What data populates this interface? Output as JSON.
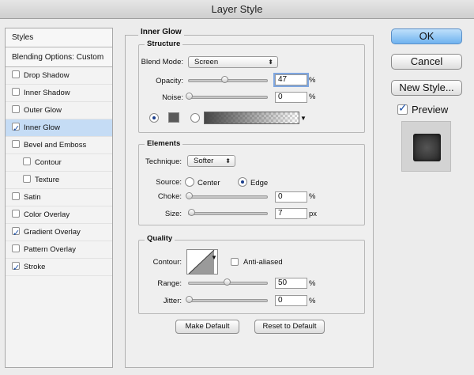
{
  "window": {
    "title": "Layer Style"
  },
  "sidebar": {
    "header": "Styles",
    "blending": "Blending Options: Custom",
    "items": [
      {
        "label": "Drop Shadow",
        "checked": false
      },
      {
        "label": "Inner Shadow",
        "checked": false
      },
      {
        "label": "Outer Glow",
        "checked": false
      },
      {
        "label": "Inner Glow",
        "checked": true
      },
      {
        "label": "Bevel and Emboss",
        "checked": false
      },
      {
        "label": "Contour",
        "checked": false
      },
      {
        "label": "Texture",
        "checked": false
      },
      {
        "label": "Satin",
        "checked": false
      },
      {
        "label": "Color Overlay",
        "checked": false
      },
      {
        "label": "Gradient Overlay",
        "checked": true
      },
      {
        "label": "Pattern Overlay",
        "checked": false
      },
      {
        "label": "Stroke",
        "checked": true
      }
    ]
  },
  "panel": {
    "title": "Inner Glow",
    "structure": {
      "title": "Structure",
      "blend_mode_label": "Blend Mode:",
      "blend_mode_value": "Screen",
      "opacity_label": "Opacity:",
      "opacity_value": "47",
      "opacity_unit": "%",
      "noise_label": "Noise:",
      "noise_value": "0",
      "noise_unit": "%"
    },
    "elements": {
      "title": "Elements",
      "technique_label": "Technique:",
      "technique_value": "Softer",
      "source_label": "Source:",
      "source_center": "Center",
      "source_edge": "Edge",
      "choke_label": "Choke:",
      "choke_value": "0",
      "choke_unit": "%",
      "size_label": "Size:",
      "size_value": "7",
      "size_unit": "px"
    },
    "quality": {
      "title": "Quality",
      "contour_label": "Contour:",
      "antialiased_label": "Anti-aliased",
      "range_label": "Range:",
      "range_value": "50",
      "range_unit": "%",
      "jitter_label": "Jitter:",
      "jitter_value": "0",
      "jitter_unit": "%"
    },
    "make_default": "Make Default",
    "reset_default": "Reset to Default"
  },
  "actions": {
    "ok": "OK",
    "cancel": "Cancel",
    "new_style": "New Style...",
    "preview": "Preview"
  },
  "colors": {
    "glow_color": "#5a5a5a",
    "selection": "#c5dcf5",
    "default_button": "#6fb2ef"
  }
}
